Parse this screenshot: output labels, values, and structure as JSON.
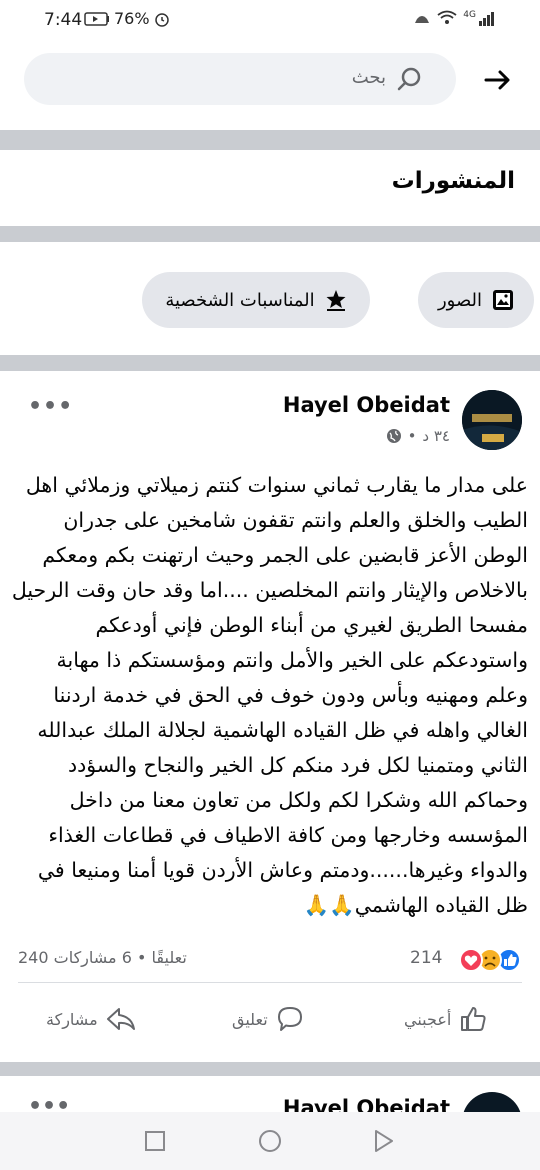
{
  "status": {
    "time": "7:44",
    "battery": "76%",
    "network": "4G"
  },
  "header": {
    "search_label": "بحث"
  },
  "section": {
    "title": "المنشورات"
  },
  "filters": {
    "photos": "الصور",
    "life_events": "المناسبات الشخصية"
  },
  "post": {
    "author": "Hayel Obeidat",
    "time": "٣٤ د",
    "text": "على مدار ما يقارب ثماني سنوات كنتم زميلاتي وزملائي اهل الطيب والخلق والعلم وانتم تقفون شامخين على جدران الوطن الأعز  قابضين على الجمر وحيث  ارتهنت بكم ومعكم بالاخلاص والإيثار وانتم المخلصين  ....اما وقد حان وقت الرحيل مفسحا الطريق لغيري من أبناء الوطن   فإني أودعكم واستودعكم  على الخير والأمل  وانتم ومؤسستكم ذا مهابة وعلم  ومهنيه وبأس ودون خوف في الحق في خدمة اردننا الغالي واهله في ظل القياده الهاشمية لجلالة الملك عبدالله الثاني ومتمنيا  لكل فرد منكم كل الخير والنجاح والسؤدد وحماكم الله وشكرا لكم ولكل من تعاون معنا من داخل المؤسسه وخارجها ومن كافة  الاطياف في قطاعات الغذاء والدواء وغيرها......ودمتم وعاش الأردن قويا  أمنا ومنيعا في ظل القياده الهاشمي🙏🙏",
    "reactions_count": "214",
    "stats": "240 تعليقًا • 6 مشاركات",
    "actions": {
      "like": "أعجبني",
      "comment": "تعليق",
      "share": "مشاركة"
    }
  },
  "next_post": {
    "author": "Hayel Obeidat"
  },
  "colors": {
    "accent_blue": "#1877f2",
    "separator": "#c9ccd1",
    "chip_bg": "#e4e6eb",
    "muted_text": "#65676b"
  }
}
